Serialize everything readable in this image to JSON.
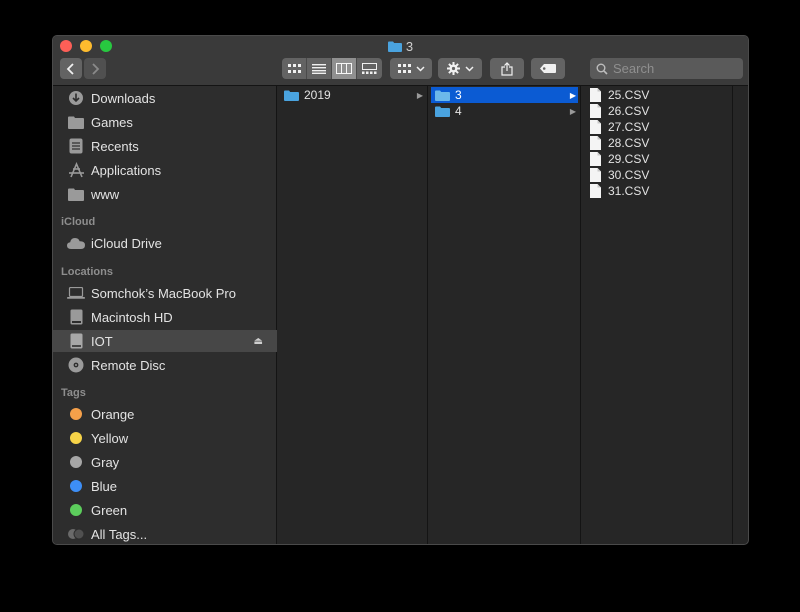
{
  "window": {
    "title": "3"
  },
  "toolbar": {
    "back": "back",
    "forward": "forward",
    "view_modes": [
      "icon-view",
      "list-view",
      "column-view",
      "gallery-view"
    ],
    "active_view": "column-view",
    "search_placeholder": "Search"
  },
  "sidebar": {
    "favorites": [
      {
        "label": "Downloads",
        "icon": "downloads-icon"
      },
      {
        "label": "Games",
        "icon": "folder-icon"
      },
      {
        "label": "Recents",
        "icon": "recents-icon"
      },
      {
        "label": "Applications",
        "icon": "applications-icon"
      },
      {
        "label": "www",
        "icon": "folder-icon"
      }
    ],
    "icloud_header": "iCloud",
    "icloud": [
      {
        "label": "iCloud Drive",
        "icon": "cloud-icon"
      }
    ],
    "locations_header": "Locations",
    "locations": [
      {
        "label": "Somchok’s MacBook Pro",
        "icon": "laptop-icon"
      },
      {
        "label": "Macintosh HD",
        "icon": "hard-drive-icon"
      },
      {
        "label": "IOT",
        "icon": "external-drive-icon",
        "selected": true,
        "eject": "⏏"
      },
      {
        "label": "Remote Disc",
        "icon": "disc-icon"
      }
    ],
    "tags_header": "Tags",
    "tags": [
      {
        "label": "Orange",
        "color": "#f5a04a"
      },
      {
        "label": "Yellow",
        "color": "#f6d348"
      },
      {
        "label": "Gray",
        "color": "#a6a6a6"
      },
      {
        "label": "Blue",
        "color": "#3d8ef6"
      },
      {
        "label": "Green",
        "color": "#5ccd5c"
      },
      {
        "label": "All Tags...",
        "color": "#6a6a6a"
      }
    ]
  },
  "columns": {
    "col1": [
      {
        "label": "2019",
        "expandable": true
      }
    ],
    "col2": [
      {
        "label": "3",
        "expandable": true,
        "selected": true
      },
      {
        "label": "4",
        "expandable": true
      }
    ],
    "col3": [
      "25.CSV",
      "26.CSV",
      "27.CSV",
      "28.CSV",
      "29.CSV",
      "30.CSV",
      "31.CSV"
    ]
  },
  "colors": {
    "selection": "#0b5bd3",
    "folder": "#4aa3df"
  }
}
